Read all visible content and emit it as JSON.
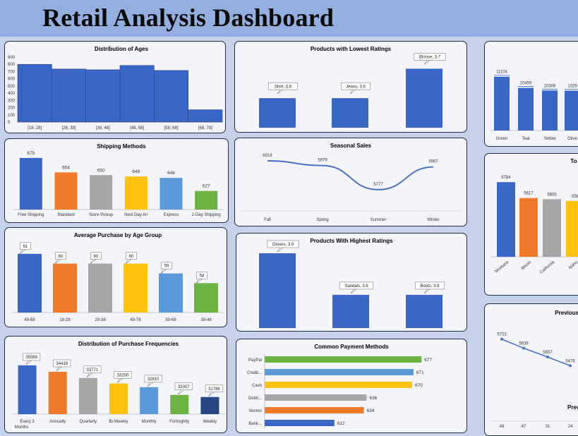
{
  "page": {
    "title": "Retail Analysis Dashboard"
  },
  "colors": {
    "blue": "#3a67c7",
    "orange": "#ef7a2c",
    "gray": "#a6a6a6",
    "yellow": "#ffc20e",
    "lightblue": "#5b9ad8",
    "green": "#6db343",
    "navy": "#274782",
    "line": "#4a72c4"
  },
  "chart_data": [
    {
      "id": "ages",
      "type": "bar",
      "title": "Distribution of Ages",
      "categories": [
        "[18, 28]",
        "[28, 38]",
        "[38, 48]",
        "[48, 58]",
        "[58, 68]",
        "[68, 78]"
      ],
      "values": [
        800,
        735,
        725,
        785,
        715,
        170
      ],
      "ylim": [
        0,
        900
      ],
      "yticks": [
        "0",
        "100",
        "200",
        "300",
        "400",
        "500",
        "600",
        "700",
        "800",
        "900"
      ],
      "grid": false
    },
    {
      "id": "lowest",
      "type": "bar",
      "title": "Products with Lowest Ratings",
      "categories": [
        "Shirt",
        "Jeans",
        "Blouse"
      ],
      "values": [
        3.6,
        3.6,
        3.7
      ],
      "labels": [
        "Shirt, 3.6",
        "Jeans, 3.6",
        "Blouse, 3.7"
      ],
      "ylim": [
        3.5,
        3.72
      ]
    },
    {
      "id": "colors",
      "type": "bar",
      "categories": [
        "Green",
        "Teal",
        "Yellow",
        "Olive"
      ],
      "values": [
        11104,
        10459,
        10308,
        10298
      ],
      "labels": [
        "11104",
        "10459",
        "10308",
        "1029"
      ],
      "ylim": [
        8000,
        11500
      ]
    },
    {
      "id": "shipping",
      "type": "bar",
      "title": "Shipping Methods",
      "categories": [
        "Free Shipping",
        "Standard",
        "Store Pickup",
        "Next Day Air",
        "Express",
        "2-Day Shipping"
      ],
      "values": [
        675,
        654,
        650,
        648,
        646,
        627
      ],
      "ylim": [
        600,
        680
      ]
    },
    {
      "id": "seasonal",
      "type": "line",
      "title": "Seasonal Sales",
      "categories": [
        "Fall",
        "Spring",
        "Summer",
        "Winter"
      ],
      "values": [
        6018,
        5979,
        5777,
        5967
      ],
      "ylim": [
        5600,
        6100
      ]
    },
    {
      "id": "states",
      "type": "bar",
      "title": "To",
      "categories": [
        "Montana",
        "Illinois",
        "California",
        "Idaho"
      ],
      "values": [
        5784,
        5617,
        5605,
        5587
      ],
      "labels": [
        "5784",
        "5617",
        "5605",
        "558"
      ],
      "ylim": [
        5000,
        5800
      ]
    },
    {
      "id": "agegroup",
      "type": "bar",
      "title": "Average Purchase by Age Group",
      "categories": [
        "49-58",
        "18-28",
        "29-38",
        "69-78",
        "59-68",
        "39-48"
      ],
      "values": [
        61,
        60,
        60,
        60,
        59,
        58
      ],
      "ylim": [
        55,
        61.2
      ]
    },
    {
      "id": "highest",
      "type": "bar",
      "title": "Products With Highest Ratings",
      "categories": [
        "Gloves",
        "Sandals",
        "Boots"
      ],
      "values": [
        3.9,
        3.8,
        3.8
      ],
      "labels": [
        "Gloves, 3.9",
        "Sandals, 3.8",
        "Boots, 3.8"
      ],
      "ylim": [
        3.72,
        3.9
      ]
    },
    {
      "id": "previous",
      "type": "line",
      "title": "Previous P",
      "ylabel": "Prev",
      "categories": [
        "48",
        "47",
        "31",
        "24"
      ],
      "values": [
        5723,
        5639,
        5557,
        5476
      ],
      "ylim": [
        5000,
        5800
      ]
    },
    {
      "id": "frequency",
      "type": "bar",
      "title": "Distribution of Purchase Frequencies",
      "categories": [
        "Every 3 Months",
        "Annually",
        "Quarterly",
        "Bi-Weekly",
        "Monthly",
        "Fortnightly",
        "Weekly"
      ],
      "values": [
        35088,
        34419,
        33771,
        33200,
        32810,
        32007,
        31786
      ],
      "ylim": [
        30000,
        35300
      ]
    },
    {
      "id": "payment",
      "type": "bar",
      "title": "Common Payment Methods",
      "orientation": "horizontal",
      "categories": [
        "PayPal",
        "Credit...",
        "Cash",
        "Debit...",
        "Venmo",
        "Bank..."
      ],
      "values": [
        677,
        671,
        670,
        636,
        634,
        612
      ],
      "xlim": [
        560,
        680
      ]
    }
  ]
}
